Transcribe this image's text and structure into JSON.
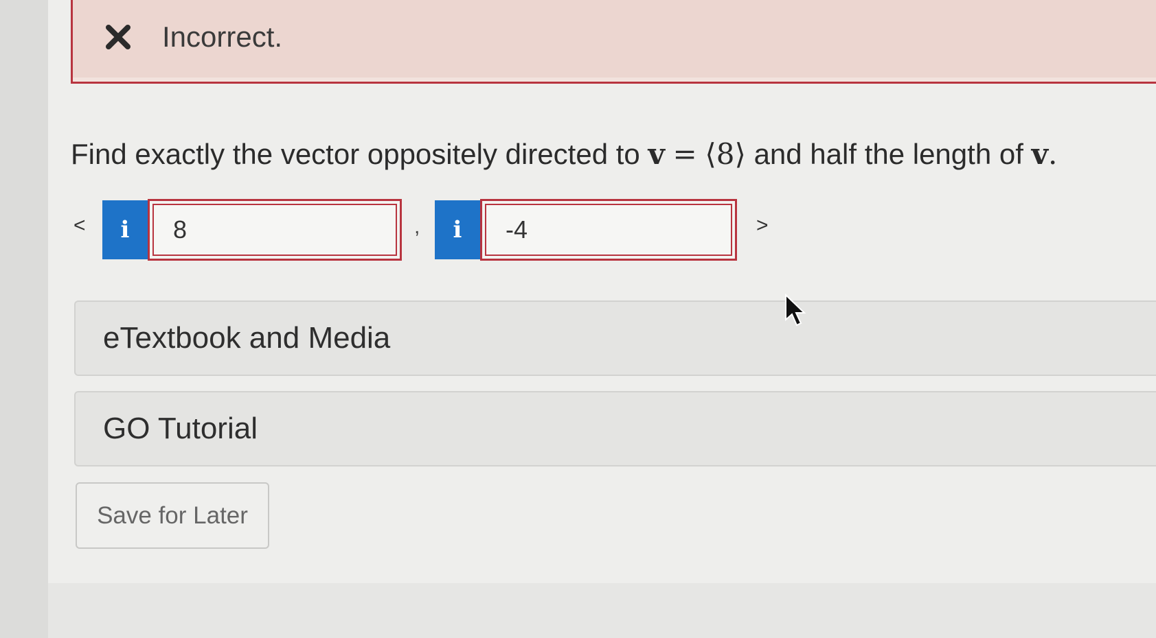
{
  "feedback": {
    "status_text": "Incorrect.",
    "icon": "x-icon",
    "border_color": "#b8343f"
  },
  "question": {
    "text_before": "Find exactly the vector oppositely directed to",
    "vector_symbol": "v",
    "equals": "=",
    "vector_value": "⟨8⟩",
    "text_after": "and half the length of",
    "vector_symbol_end": "v",
    "period": "."
  },
  "answer": {
    "open_bracket": "<",
    "close_bracket": ">",
    "separator": ",",
    "info_icon_glyph": "i",
    "components": [
      {
        "value": "8"
      },
      {
        "value": "-4"
      }
    ],
    "info_color": "#1e73c8"
  },
  "resources": {
    "etextbook_label": "eTextbook and Media",
    "tutorial_label": "GO Tutorial"
  },
  "actions": {
    "save_label": "Save for Later"
  }
}
